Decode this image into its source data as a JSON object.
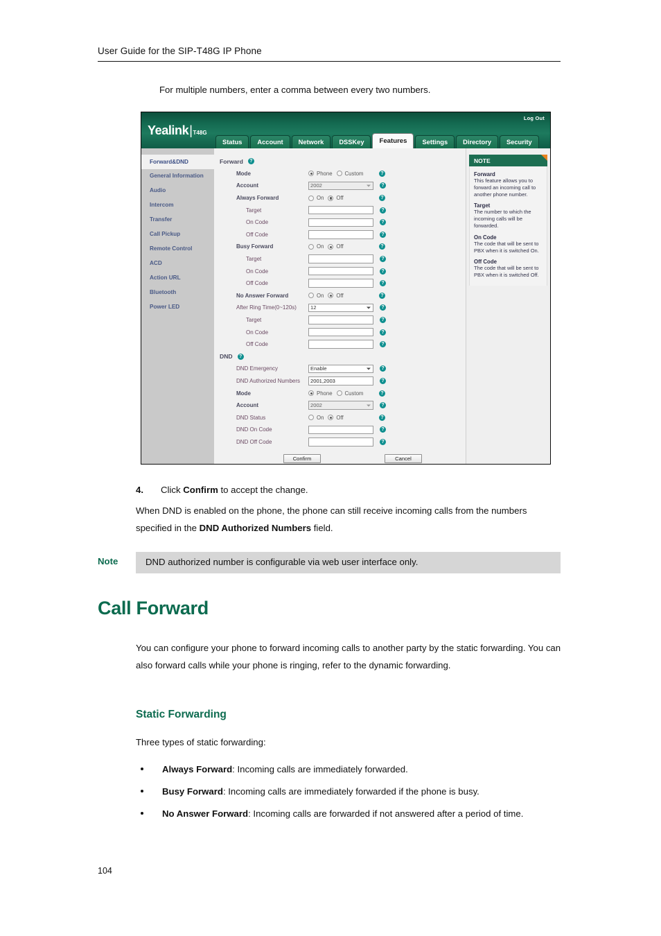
{
  "page": {
    "running_head": "User Guide for the SIP-T48G IP Phone",
    "number": "104"
  },
  "intro_line": "For multiple numbers, enter a comma between every two numbers.",
  "screenshot": {
    "logout_label": "Log Out",
    "brand": {
      "name": "Yealink",
      "separator": "|",
      "model": "T48G"
    },
    "tabs": [
      {
        "label": "Status",
        "active": false
      },
      {
        "label": "Account",
        "active": false
      },
      {
        "label": "Network",
        "active": false
      },
      {
        "label": "DSSKey",
        "active": false
      },
      {
        "label": "Features",
        "active": true
      },
      {
        "label": "Settings",
        "active": false
      },
      {
        "label": "Directory",
        "active": false
      },
      {
        "label": "Security",
        "active": false
      }
    ],
    "sidebar": [
      {
        "label": "Forward&DND",
        "active": true
      },
      {
        "label": "General Information",
        "active": false
      },
      {
        "label": "Audio",
        "active": false
      },
      {
        "label": "Intercom",
        "active": false
      },
      {
        "label": "Transfer",
        "active": false
      },
      {
        "label": "Call Pickup",
        "active": false
      },
      {
        "label": "Remote Control",
        "active": false
      },
      {
        "label": "ACD",
        "active": false
      },
      {
        "label": "Action URL",
        "active": false
      },
      {
        "label": "Bluetooth",
        "active": false
      },
      {
        "label": "Power LED",
        "active": false
      }
    ],
    "help_glyph": "?",
    "forward_section": {
      "title": "Forward",
      "mode": {
        "label": "Mode",
        "options": [
          "Phone",
          "Custom"
        ],
        "selected": "Phone"
      },
      "account": {
        "label": "Account",
        "value": "2002"
      },
      "always_forward": {
        "label": "Always Forward",
        "options": [
          "On",
          "Off"
        ],
        "selected": "Off"
      },
      "always_target": {
        "label": "Target",
        "value": ""
      },
      "always_on_code": {
        "label": "On Code",
        "value": ""
      },
      "always_off_code": {
        "label": "Off Code",
        "value": ""
      },
      "busy_forward": {
        "label": "Busy Forward",
        "options": [
          "On",
          "Off"
        ],
        "selected": "Off"
      },
      "busy_target": {
        "label": "Target",
        "value": ""
      },
      "busy_on_code": {
        "label": "On Code",
        "value": ""
      },
      "busy_off_code": {
        "label": "Off Code",
        "value": ""
      },
      "no_answer_forward": {
        "label": "No Answer Forward",
        "options": [
          "On",
          "Off"
        ],
        "selected": "Off"
      },
      "after_ring_time": {
        "label": "After Ring Time(0~120s)",
        "value": "12"
      },
      "na_target": {
        "label": "Target",
        "value": ""
      },
      "na_on_code": {
        "label": "On Code",
        "value": ""
      },
      "na_off_code": {
        "label": "Off Code",
        "value": ""
      }
    },
    "dnd_section": {
      "title": "DND",
      "dnd_emergency": {
        "label": "DND Emergency",
        "value": "Enable"
      },
      "dnd_authorized_numbers": {
        "label": "DND Authorized Numbers",
        "value": "2001,2003"
      },
      "mode": {
        "label": "Mode",
        "options": [
          "Phone",
          "Custom"
        ],
        "selected": "Phone"
      },
      "account": {
        "label": "Account",
        "value": "2002"
      },
      "dnd_status": {
        "label": "DND Status",
        "options": [
          "On",
          "Off"
        ],
        "selected": "Off"
      },
      "dnd_on_code": {
        "label": "DND On Code",
        "value": ""
      },
      "dnd_off_code": {
        "label": "DND Off Code",
        "value": ""
      }
    },
    "buttons": {
      "confirm": "Confirm",
      "cancel": "Cancel"
    },
    "note_panel": {
      "header": "NOTE",
      "entries": [
        {
          "title": "Forward",
          "text": "This feature allows you to forward an incoming call to another phone number."
        },
        {
          "title": "Target",
          "text": "The number to which the incoming calls will be forwarded."
        },
        {
          "title": "On Code",
          "text": "The code that will be sent to PBX when it is switched On."
        },
        {
          "title": "Off Code",
          "text": "The code that will be sent to PBX when it is switched Off."
        }
      ]
    }
  },
  "steps": {
    "number": "4.",
    "text_pre": "Click ",
    "text_bold": "Confirm",
    "text_post": " to accept the change."
  },
  "dnd_paragraph": {
    "pre": "When DND is enabled on the phone, the phone can still receive incoming calls from the numbers specified in the ",
    "bold": "DND Authorized Numbers",
    "post": " field."
  },
  "note_callout": {
    "tag": "Note",
    "text": "DND authorized number is configurable via web user interface only."
  },
  "call_forward": {
    "heading": "Call Forward",
    "paragraph": "You can configure your phone to forward incoming calls to another party by the static forwarding. You can also forward calls while your phone is ringing, refer to the dynamic forwarding.",
    "sub_heading": "Static Forwarding",
    "lead_in": "Three types of static forwarding:",
    "bullets": [
      {
        "term": "Always Forward",
        "desc": ": Incoming calls are immediately forwarded."
      },
      {
        "term": "Busy Forward",
        "desc": ": Incoming calls are immediately forwarded if the phone is busy."
      },
      {
        "term": "No Answer Forward",
        "desc": ": Incoming calls are forwarded if not answered after a period of time."
      }
    ]
  },
  "colors": {
    "brand_green": "#0c6b4f",
    "header_green": "#1d7a5e",
    "help_teal": "#0e8f8f",
    "note_orange": "#e8821e",
    "sidebar_gray": "#c9c9c9",
    "note_strip_gray": "#d6d6d6"
  }
}
